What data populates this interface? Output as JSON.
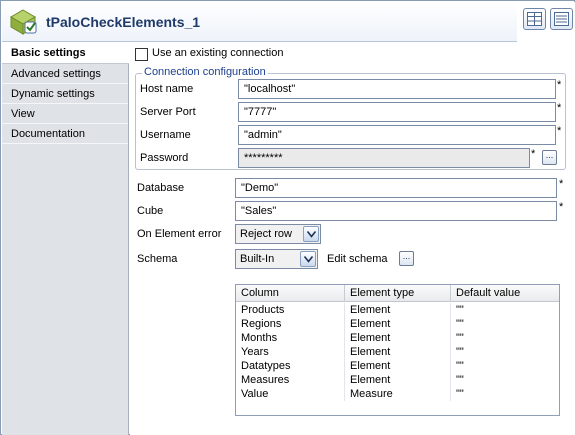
{
  "window": {
    "title": "tPaloCheckElements_1"
  },
  "sidebar": {
    "items": [
      {
        "label": "Basic settings",
        "active": true
      },
      {
        "label": "Advanced settings",
        "active": false
      },
      {
        "label": "Dynamic settings",
        "active": false
      },
      {
        "label": "View",
        "active": false
      },
      {
        "label": "Documentation",
        "active": false
      }
    ]
  },
  "form": {
    "use_existing_connection": {
      "label": "Use an existing connection",
      "checked": false
    },
    "connection_group": {
      "title": "Connection configuration",
      "host": {
        "label": "Host name",
        "value": "\"localhost\""
      },
      "port": {
        "label": "Server Port",
        "value": "\"7777\""
      },
      "username": {
        "label": "Username",
        "value": "\"admin\""
      },
      "password": {
        "label": "Password",
        "value": "*********"
      }
    },
    "database": {
      "label": "Database",
      "value": "\"Demo\""
    },
    "cube": {
      "label": "Cube",
      "value": "\"Sales\""
    },
    "on_element_error": {
      "label": "On Element error",
      "value": "Reject row"
    },
    "schema": {
      "label": "Schema",
      "value": "Built-In",
      "edit_label": "Edit schema"
    },
    "required_marker": "*",
    "dots_label": "..."
  },
  "schema_table": {
    "headers": [
      "Column",
      "Element type",
      "Default value"
    ],
    "rows": [
      [
        "Products",
        "Element",
        "\"\""
      ],
      [
        "Regions",
        "Element",
        "\"\""
      ],
      [
        "Months",
        "Element",
        "\"\""
      ],
      [
        "Years",
        "Element",
        "\"\""
      ],
      [
        "Datatypes",
        "Element",
        "\"\""
      ],
      [
        "Measures",
        "Element",
        "\"\""
      ],
      [
        "Value",
        "Measure",
        "\"\""
      ]
    ]
  }
}
